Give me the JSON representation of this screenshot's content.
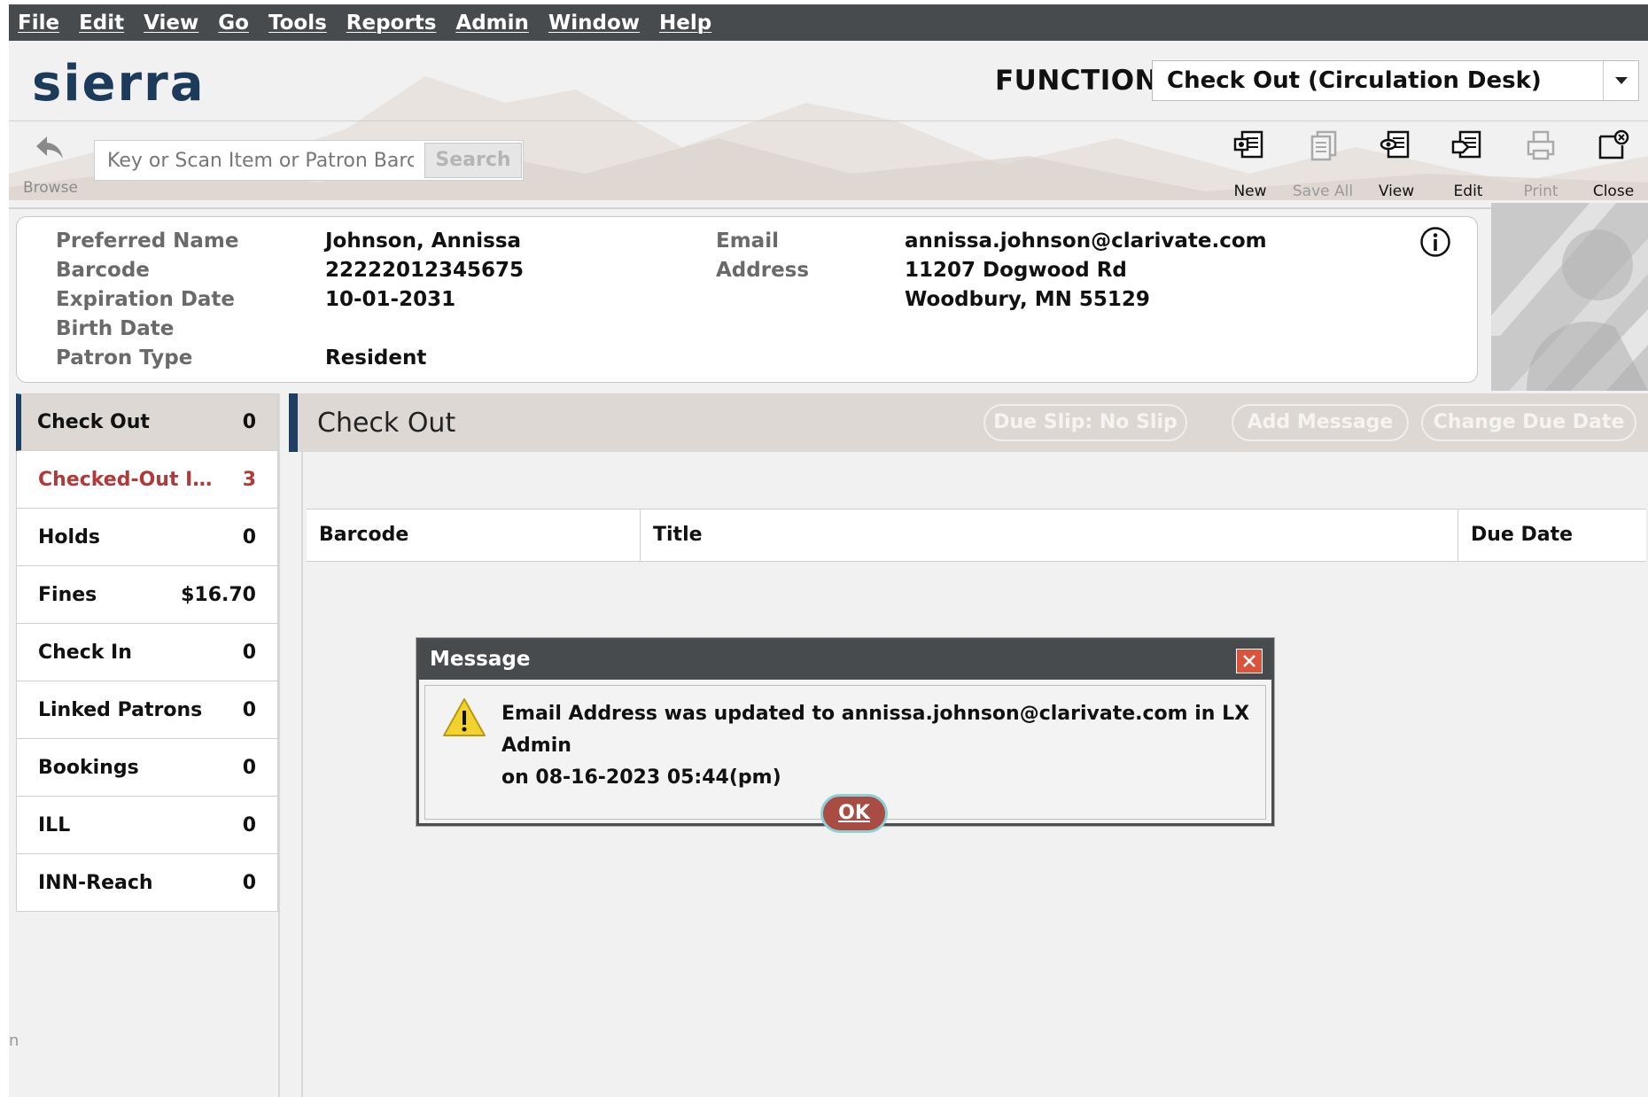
{
  "menubar": {
    "items": [
      "File",
      "Edit",
      "View",
      "Go",
      "Tools",
      "Reports",
      "Admin",
      "Window",
      "Help"
    ]
  },
  "header": {
    "logo": "sierra",
    "function_label": "FUNCTION",
    "function_value": "Check Out (Circulation Desk)"
  },
  "toolbar": {
    "browse_label": "Browse",
    "search_placeholder": "Key or Scan Item or Patron Barcode",
    "search_button": "Search",
    "buttons": [
      {
        "label": "New",
        "icon": "new-record-icon",
        "enabled": true
      },
      {
        "label": "Save All",
        "icon": "save-all-icon",
        "enabled": false
      },
      {
        "label": "View",
        "icon": "view-record-icon",
        "enabled": true
      },
      {
        "label": "Edit",
        "icon": "edit-record-icon",
        "enabled": true
      },
      {
        "label": "Print",
        "icon": "print-icon",
        "enabled": false
      },
      {
        "label": "Close",
        "icon": "close-record-icon",
        "enabled": true
      }
    ]
  },
  "patron": {
    "labels": {
      "preferred_name": "Preferred Name",
      "barcode": "Barcode",
      "expiration_date": "Expiration Date",
      "birth_date": "Birth Date",
      "patron_type": "Patron Type",
      "email": "Email",
      "address": "Address"
    },
    "values": {
      "preferred_name": "Johnson, Annissa",
      "barcode": "22222012345675",
      "expiration_date": "10-01-2031",
      "birth_date": "",
      "patron_type": "Resident",
      "email": "annissa.johnson@clarivate.com",
      "address_line1": "11207 Dogwood Rd",
      "address_line2": "Woodbury, MN 55129"
    }
  },
  "nav": {
    "items": [
      {
        "label": "Check Out",
        "count": "0"
      },
      {
        "label": "Checked-Out Ite...",
        "count": "3"
      },
      {
        "label": "Holds",
        "count": "0"
      },
      {
        "label": "Fines",
        "count": "$16.70"
      },
      {
        "label": "Check In",
        "count": "0"
      },
      {
        "label": "Linked Patrons",
        "count": "0"
      },
      {
        "label": "Bookings",
        "count": "0"
      },
      {
        "label": "ILL",
        "count": "0"
      },
      {
        "label": "INN-Reach",
        "count": "0"
      }
    ]
  },
  "main": {
    "title": "Check Out",
    "buttons": {
      "due_slip": "Due Slip: No Slip",
      "add_message": "Add Message",
      "change_due_date": "Change Due Date"
    },
    "columns": [
      "Barcode",
      "Title",
      "Due Date"
    ]
  },
  "dialog": {
    "title": "Message",
    "message_line1": "Email Address was updated to annissa.johnson@clarivate.com in LX Admin",
    "message_line2": "on 08-16-2023 05:44(pm)",
    "ok_label": "OK"
  },
  "colors": {
    "menubar_bg": "#474b4d",
    "brand_navy": "#1d3f63",
    "alert_red": "#b03a3a",
    "ok_button": "#a94c43"
  }
}
